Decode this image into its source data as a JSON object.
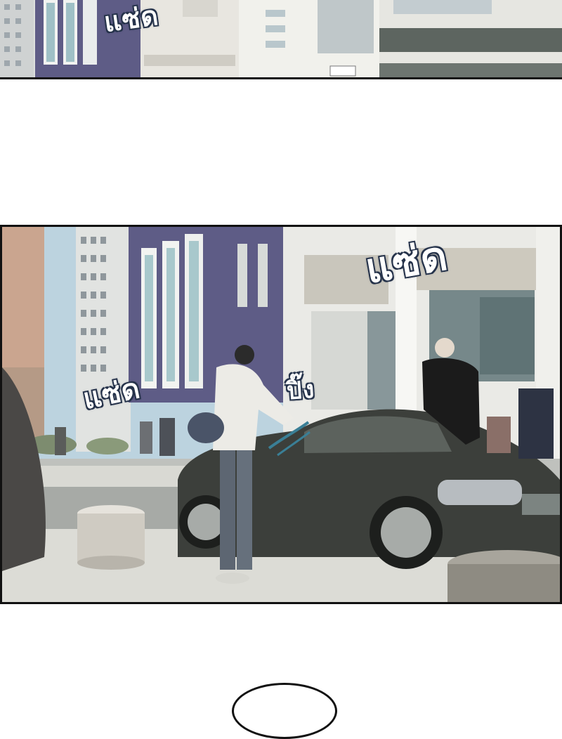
{
  "sound_effects": {
    "top_panel_text": "แซ่ด",
    "main_big_text": "แซ่ด",
    "main_left_text": "แซ่ด",
    "car_beep_text": "ปิ๊ง"
  },
  "colors": {
    "panel_border": "#111111",
    "sfx_fill": "#ffffff",
    "sfx_outline": "#25324a",
    "car_body": "#3c3f3b",
    "sky": "#bcd3df",
    "purple_building": "#5e5c86"
  }
}
